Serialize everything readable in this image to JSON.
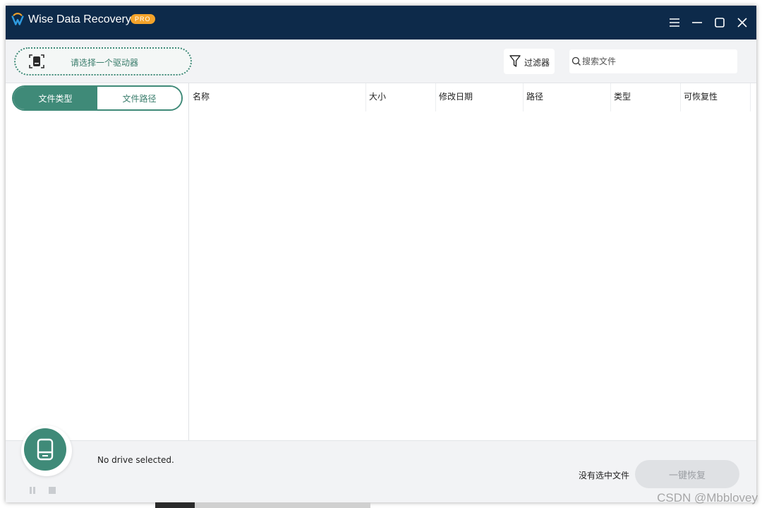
{
  "app": {
    "title": "Wise Data Recovery",
    "badge": "PRO",
    "accent_color": "#3f8a78",
    "titlebar_color": "#0d2a4a",
    "badge_color": "#f4a32a"
  },
  "window_controls": [
    "menu-icon",
    "minimize-icon",
    "maximize-icon",
    "close-icon"
  ],
  "toolbar": {
    "drive_select_label": "请选择一个驱动器",
    "filter_label": "过滤器",
    "search_placeholder": "搜索文件"
  },
  "sidebar": {
    "tabs": [
      {
        "label": "文件类型",
        "active": true
      },
      {
        "label": "文件路径",
        "active": false
      }
    ]
  },
  "table": {
    "columns": [
      "名称",
      "大小",
      "修改日期",
      "路径",
      "类型",
      "可恢复性"
    ],
    "rows": []
  },
  "footer": {
    "status": "No drive selected.",
    "selection_status": "没有选中文件",
    "recover_button": "一键恢复",
    "recover_enabled": false
  },
  "watermark": "CSDN @Mbblovey"
}
